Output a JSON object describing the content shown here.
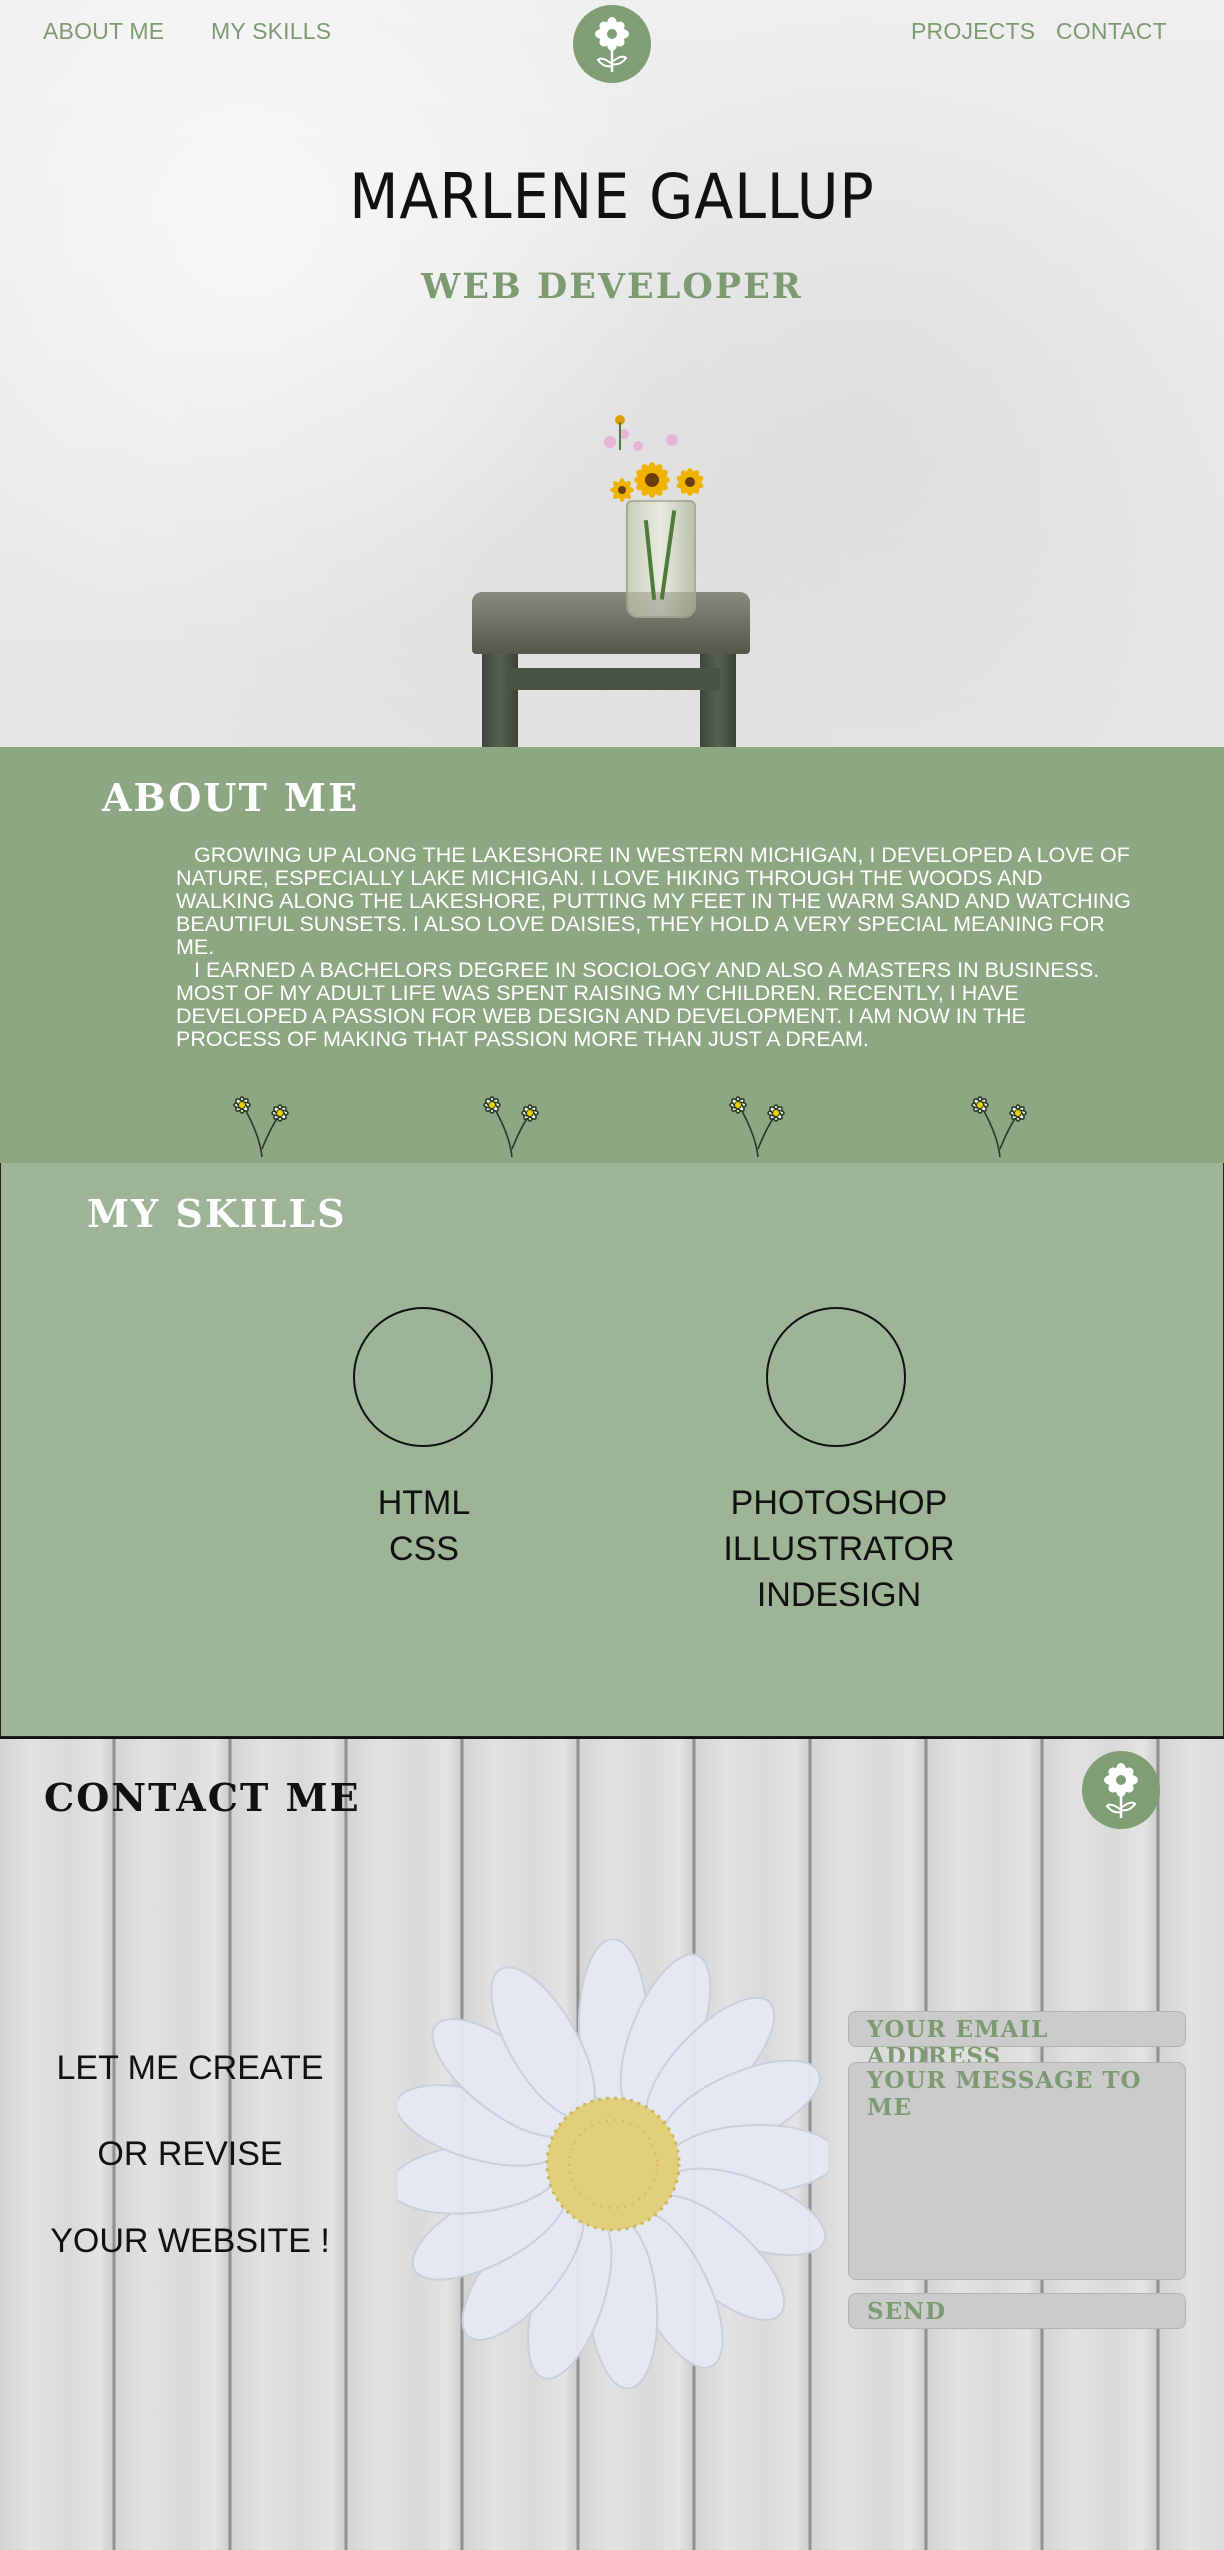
{
  "nav": {
    "about_label": "ABOUT ME",
    "skills_label": "MY SKILLS",
    "projects_label": "PROJECTS",
    "contact_label": "CONTACT"
  },
  "hero": {
    "name": "MARLENE GALLUP",
    "title": "WEB DEVELOPER"
  },
  "about": {
    "heading": "ABOUT ME",
    "paragraph1": "Growing up along the lakeshore in western Michigan, I developed a love of nature, especially Lake Michigan.  I love hiking through the woods and walking along the lakeshore,  putting my feet in the warm sand and watching beautiful sunsets.  I also love daisies, they hold a very special meaning for me.",
    "paragraph2": "I earned a bachelors degree  in sociology and also a masters in business.   Most of my adult life was spent raising my children.   Recently, I have developed a passion for web design and development.  I am now in the  process of making that passion more than just a dream."
  },
  "skills": {
    "heading": "MY SKILLS",
    "groups": [
      {
        "items": [
          "HTML",
          "CSS"
        ]
      },
      {
        "items": [
          "PHOTOSHOP",
          "ILLUSTRATOR",
          "INDESIGN"
        ]
      }
    ]
  },
  "contact": {
    "heading": "CONTACT ME",
    "cta": [
      "LET ME CREATE",
      "OR REVISE",
      "YOUR WEBSITE !"
    ],
    "email_placeholder": "YOUR EMAIL ADDRESS",
    "message_placeholder": "YOUR MESSAGE TO ME",
    "send_label": "SEND"
  },
  "colors": {
    "accent_green": "#7e9a73",
    "about_bg": "#8ca781",
    "skills_bg": "#9db497"
  },
  "icons": [
    "daisy-logo-icon",
    "daisy-doodle-icon",
    "daisy-illustration"
  ]
}
